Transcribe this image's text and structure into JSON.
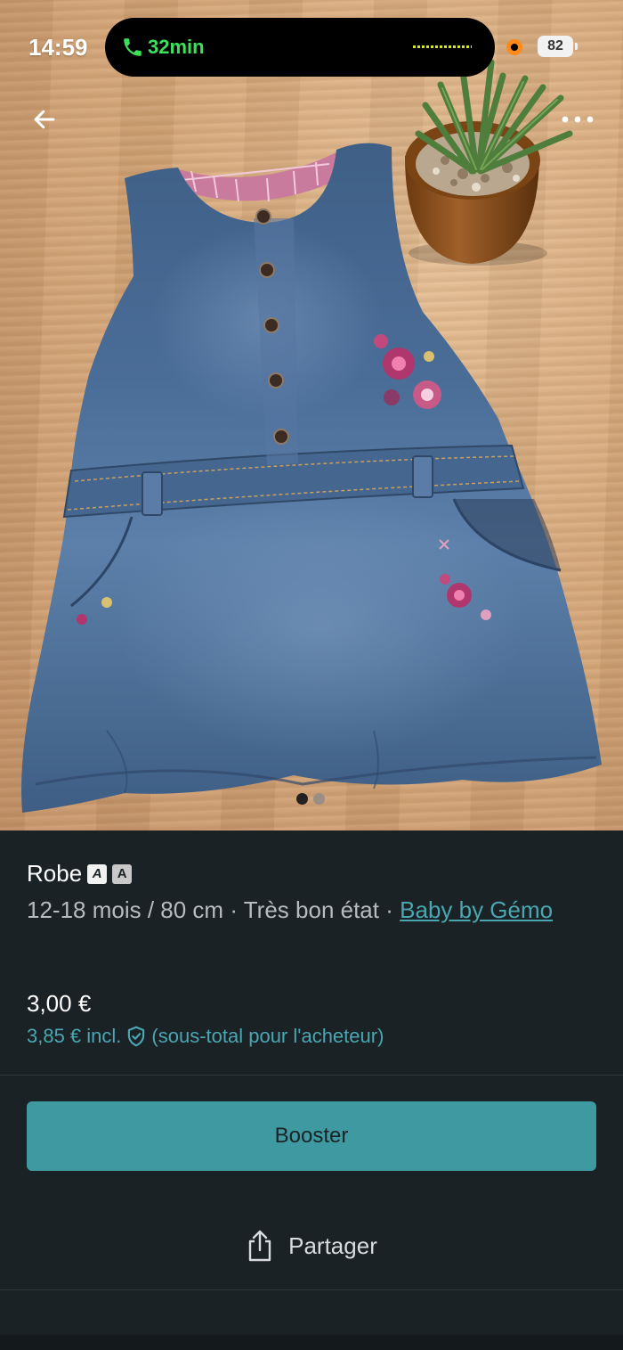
{
  "status_bar": {
    "time": "14:59",
    "call_duration": "32min",
    "battery": "82"
  },
  "photo": {
    "current_index": 1,
    "total": 2
  },
  "item": {
    "title": "Robe",
    "size": "12-18 mois / 80 cm",
    "separator": "·",
    "condition": "Très bon état",
    "brand": "Baby by Gémo",
    "price": "3,00 €",
    "price_incl": "3,85 € incl.",
    "price_incl_note": "(sous-total pour l'acheteur)"
  },
  "actions": {
    "booster_label": "Booster",
    "share_label": "Partager"
  },
  "colors": {
    "accent": "#3f99a1",
    "link": "#4aa6b0",
    "background": "#1b2225",
    "call_green": "#3ee05a"
  },
  "icons": [
    "phone-icon",
    "back-arrow-icon",
    "more-icon",
    "shield-check-icon",
    "share-icon"
  ]
}
